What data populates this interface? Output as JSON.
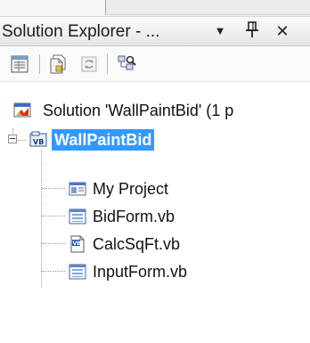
{
  "panel": {
    "title": "Solution Explorer - ...",
    "title_buttons": {
      "dropdown": "▼",
      "pin": "ඇ",
      "close": "✕"
    },
    "toolbar": [
      {
        "name": "properties-icon"
      },
      {
        "name": "show-all-files-icon"
      },
      {
        "name": "refresh-icon"
      },
      {
        "name": "class-view-icon"
      }
    ]
  },
  "tree": {
    "solution": {
      "label": "Solution 'WallPaintBid' (1 p",
      "icon": "solution-icon"
    },
    "project": {
      "label": "WallPaintBid",
      "icon": "vb-project-icon",
      "expanded": true,
      "selected": true
    },
    "items": [
      {
        "label": "My Project",
        "icon": "my-project-icon"
      },
      {
        "label": "BidForm.vb",
        "icon": "form-icon"
      },
      {
        "label": "CalcSqFt.vb",
        "icon": "vb-module-icon"
      },
      {
        "label": "InputForm.vb",
        "icon": "form-icon"
      }
    ]
  },
  "colors": {
    "selection": "#3399ff",
    "selection_text": "#ffffff"
  }
}
